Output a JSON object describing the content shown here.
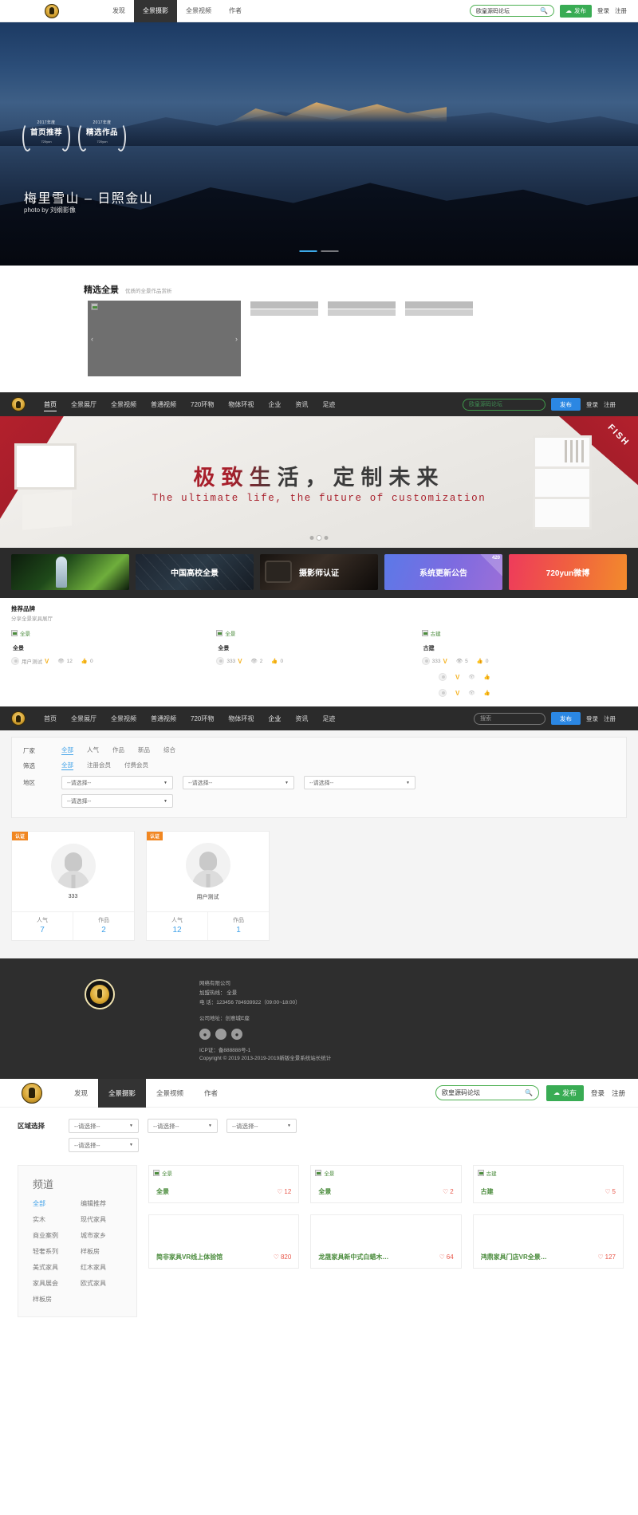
{
  "site_top": {
    "nav": [
      {
        "label": "发现",
        "active": false
      },
      {
        "label": "全景摄影",
        "active": true
      },
      {
        "label": "全景视频",
        "active": false
      },
      {
        "label": "作者",
        "active": false
      }
    ],
    "search_value": "欧皇源码论坛",
    "publish_label": "发布",
    "login_label": "登录",
    "register_label": "注册",
    "hero": {
      "badge_left_year": "2017年度",
      "badge_left_text": "首页推荐",
      "badge_left_sub": "720yun",
      "badge_right_year": "2017年度",
      "badge_right_text": "精选作品",
      "badge_right_sub": "720yun",
      "title": "梅里雪山 – 日照金山",
      "author": "photo by 刘纲影像"
    },
    "featured": {
      "heading": "精选全景",
      "desc": "优质的全景作品赏析"
    }
  },
  "site_dark": {
    "nav": [
      {
        "label": "首页",
        "active": true
      },
      {
        "label": "全景展厅",
        "active": false
      },
      {
        "label": "全景视频",
        "active": false
      },
      {
        "label": "普通视频",
        "active": false
      },
      {
        "label": "720环物",
        "active": false
      },
      {
        "label": "物体环视",
        "active": false
      },
      {
        "label": "企业",
        "active": false
      },
      {
        "label": "资讯",
        "active": false
      },
      {
        "label": "足迹",
        "active": false
      }
    ],
    "search_value": "欧皇源码论坛",
    "publish_label": "发布",
    "login_label": "登录",
    "register_label": "注册",
    "banner": {
      "title_cn": "极致生活，定制未来",
      "title_en": "The ultimate life, the future of customization",
      "corner_tag": "FISH"
    },
    "promos": [
      {
        "label": ""
      },
      {
        "label": "中国高校全景"
      },
      {
        "label": "摄影师认证"
      },
      {
        "label": "系统更新公告",
        "corner": "420"
      },
      {
        "label": "720yun微博"
      }
    ],
    "brand_section": {
      "heading": "推荐品牌",
      "desc": "分享全景家具展厅",
      "items": [
        {
          "alt": "全景",
          "title": "全景",
          "author": "用户测试",
          "views": "12",
          "likes": "0"
        },
        {
          "alt": "全景",
          "title": "全景",
          "author": "333",
          "views": "2",
          "likes": "0"
        },
        {
          "alt": "古建",
          "title": "古建",
          "author": "333",
          "views": "5",
          "likes": "0"
        }
      ]
    }
  },
  "site_company": {
    "nav": [
      {
        "label": "首页",
        "active": false
      },
      {
        "label": "全景展厅",
        "active": false
      },
      {
        "label": "全景视频",
        "active": false
      },
      {
        "label": "普通视频",
        "active": false
      },
      {
        "label": "720环物",
        "active": false
      },
      {
        "label": "物体环视",
        "active": false
      },
      {
        "label": "企业",
        "active": true
      },
      {
        "label": "资讯",
        "active": false
      },
      {
        "label": "足迹",
        "active": false
      }
    ],
    "search_placeholder": "搜索",
    "publish_label": "发布",
    "login_label": "登录",
    "register_label": "注册",
    "filters": [
      {
        "key": "厂家",
        "options": [
          {
            "label": "全部",
            "on": true
          },
          {
            "label": "人气",
            "on": false
          },
          {
            "label": "作品",
            "on": false
          },
          {
            "label": "新品",
            "on": false
          },
          {
            "label": "综合",
            "on": false
          }
        ]
      },
      {
        "key": "筛选",
        "options": [
          {
            "label": "全部",
            "on": true
          },
          {
            "label": "注册会员",
            "on": false
          },
          {
            "label": "付费会员",
            "on": false
          }
        ]
      }
    ],
    "region_key": "地区",
    "region_selects": [
      "--请选择--",
      "--请选择--",
      "--请选择--",
      "--请选择--"
    ],
    "users": [
      {
        "badge": "认证",
        "name": "333",
        "stat1_label": "人气",
        "stat1_value": "7",
        "stat2_label": "作品",
        "stat2_value": "2"
      },
      {
        "badge": "认证",
        "name": "用户测试",
        "stat1_label": "人气",
        "stat1_value": "12",
        "stat2_label": "作品",
        "stat2_value": "1"
      }
    ]
  },
  "footer": {
    "company": "网络有限公司",
    "hotline": "加盟热线：     全景",
    "phone": "电 话：123456 784939922（09:00~18:00）",
    "address": "公司地址：创意城E座",
    "icp": "ICP证：备888888号-1",
    "copyright": "Copyright © 2019 2013-2019-2019新版全景系统站长统计",
    "socials": [
      "wechat-icon",
      "weibo-icon",
      "qq-icon"
    ]
  },
  "site_bottom": {
    "nav": [
      {
        "label": "发现",
        "active": false
      },
      {
        "label": "全景摄影",
        "active": true
      },
      {
        "label": "全景视频",
        "active": false
      },
      {
        "label": "作者",
        "active": false
      }
    ],
    "search_value": "欧皇源码论坛",
    "publish_label": "发布",
    "login_label": "登录",
    "register_label": "注册",
    "area_label": "区域选择",
    "area_selects": [
      "--请选择--",
      "--请选择--",
      "--请选择--",
      "--请选择--"
    ],
    "channel": {
      "title": "频道",
      "items": [
        {
          "label": "全部",
          "on": true
        },
        {
          "label": "编辑推荐",
          "on": false
        },
        {
          "label": "实木",
          "on": false
        },
        {
          "label": "现代家具",
          "on": false
        },
        {
          "label": "商业案例",
          "on": false
        },
        {
          "label": "城市家乡",
          "on": false
        },
        {
          "label": "轻奢系列",
          "on": false
        },
        {
          "label": "样板房",
          "on": false
        },
        {
          "label": "美式家具",
          "on": false
        },
        {
          "label": "红木家具",
          "on": false
        },
        {
          "label": "家具展会",
          "on": false
        },
        {
          "label": "欧式家具",
          "on": false
        },
        {
          "label": "样板房",
          "on": false
        }
      ]
    },
    "cards_row1": [
      {
        "alt": "全景",
        "name": "全景",
        "likes": "12"
      },
      {
        "alt": "全景",
        "name": "全景",
        "likes": "2"
      },
      {
        "alt": "古建",
        "name": "古建",
        "likes": "5"
      }
    ],
    "cards_row2": [
      {
        "name": "简非家具VR线上体验馆",
        "likes": "820"
      },
      {
        "name": "龙晟家具新中式白蜡木…",
        "likes": "64"
      },
      {
        "name": "鸿鼎家具门店VR全景…",
        "likes": "127"
      }
    ]
  }
}
